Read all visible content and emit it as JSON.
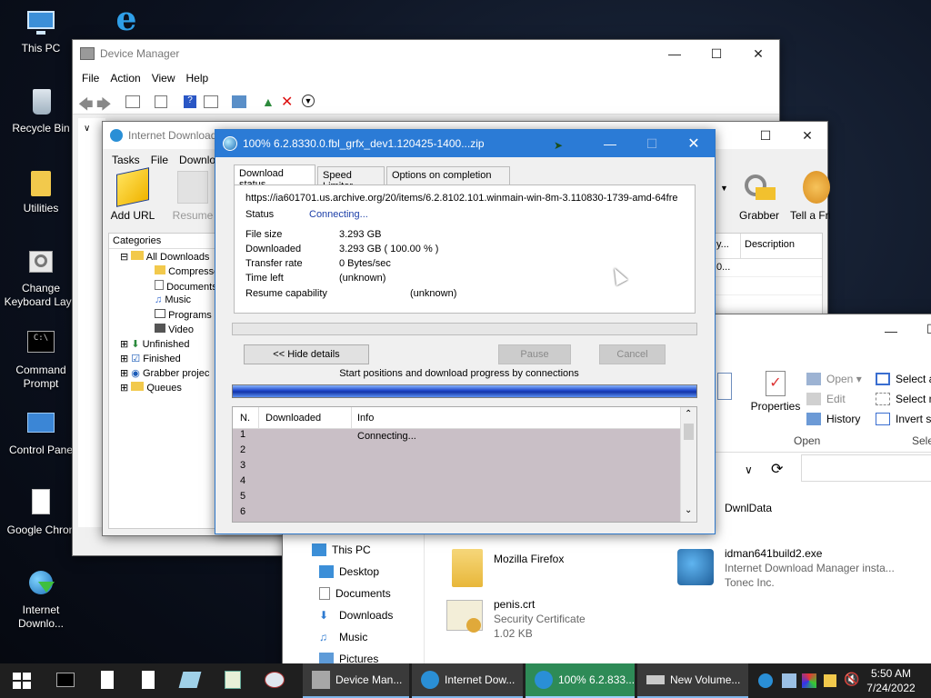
{
  "desktop": {
    "icons": [
      {
        "label": "This PC"
      },
      {
        "label": "Recycle Bin"
      },
      {
        "label": "Utilities"
      },
      {
        "label": "Change Keyboard Layo"
      },
      {
        "label": "Command Prompt"
      },
      {
        "label": "Control Pane"
      },
      {
        "label": "Google Chron"
      },
      {
        "label": "Internet Downlo..."
      }
    ]
  },
  "device_manager": {
    "title": "Device Manager",
    "menu": [
      "File",
      "Action",
      "View",
      "Help"
    ]
  },
  "idm_main": {
    "title": "Internet Download",
    "menu": [
      "Tasks",
      "File",
      "Downlo"
    ],
    "toolbar": {
      "add_url": "Add URL",
      "resume": "Resume",
      "grabber": "Grabber",
      "tell_friend": "Tell a Fri"
    },
    "categories_header": "Categories",
    "tree": [
      "All Downloads",
      "Compresse",
      "Documents",
      "Music",
      "Programs",
      "Video",
      "Unfinished",
      "Finished",
      "Grabber projec",
      "Queues"
    ],
    "columns": {
      "col1": "y...",
      "description": "Description"
    },
    "cell": "0..."
  },
  "explorer": {
    "ribbon": {
      "properties": "Properties",
      "open": "Open",
      "edit": "Edit",
      "history": "History",
      "open_group": "Open",
      "select_all": "Select al",
      "select_none": "Select no",
      "invert": "Invert se",
      "select_group": "Selec"
    },
    "nav": [
      "This PC",
      "Desktop",
      "Documents",
      "Downloads",
      "Music",
      "Pictures"
    ],
    "files": [
      {
        "name": "DwnlData",
        "line2": "",
        "line3": ""
      },
      {
        "name": "Mozilla Firefox",
        "line2": "",
        "line3": ""
      },
      {
        "name": "idman641build2.exe",
        "line2": "Internet Download Manager insta...",
        "line3": "Tonec Inc."
      },
      {
        "name": "penis.crt",
        "line2": "Security Certificate",
        "line3": "1.02 KB"
      }
    ]
  },
  "dialog": {
    "title": "100% 6.2.8330.0.fbl_grfx_dev1.120425-1400...zip",
    "tabs": [
      "Download status",
      "Speed Limiter",
      "Options on completion"
    ],
    "url": "https://ia601701.us.archive.org/20/items/6.2.8102.101.winmain-win-8m-3.110830-1739-amd-64fre",
    "status_label": "Status",
    "status_value": "Connecting...",
    "file_size_label": "File size",
    "file_size_value": "3.293  GB",
    "downloaded_label": "Downloaded",
    "downloaded_value": "3.293  GB  ( 100.00 % )",
    "rate_label": "Transfer rate",
    "rate_value": "0  Bytes/sec",
    "time_left_label": "Time left",
    "time_left_value": "(unknown)",
    "resume_label": "Resume capability",
    "resume_value": "(unknown)",
    "hide_details": "<< Hide details",
    "pause": "Pause",
    "cancel": "Cancel",
    "connections_caption": "Start positions and download progress by connections",
    "progress": 1.0,
    "table": {
      "headers": [
        "N.",
        "Downloaded",
        "Info"
      ],
      "rows": [
        {
          "n": "1",
          "info": "Connecting..."
        },
        {
          "n": "2",
          "info": ""
        },
        {
          "n": "3",
          "info": ""
        },
        {
          "n": "4",
          "info": ""
        },
        {
          "n": "5",
          "info": ""
        },
        {
          "n": "6",
          "info": ""
        }
      ]
    }
  },
  "taskbar": {
    "tasks": [
      "Device Man...",
      "Internet Dow...",
      "100% 6.2.833...",
      "New Volume..."
    ],
    "time": "5:50 AM",
    "date": "7/24/2022"
  },
  "colors": {
    "accent": "#0078d7",
    "taskbar": "#1f1f1f",
    "active_task": "#2e8b57",
    "status_blue": "#1c3fa8"
  }
}
